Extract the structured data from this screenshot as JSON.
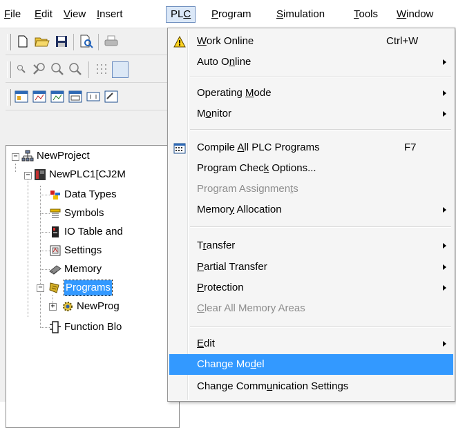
{
  "menubar": {
    "items": [
      {
        "pre": "",
        "u": "F",
        "post": "ile"
      },
      {
        "pre": "",
        "u": "E",
        "post": "dit"
      },
      {
        "pre": "",
        "u": "V",
        "post": "iew"
      },
      {
        "pre": "",
        "u": "I",
        "post": "nsert"
      },
      {
        "pre": "PL",
        "u": "C",
        "post": ""
      },
      {
        "pre": "",
        "u": "P",
        "post": "rogram"
      },
      {
        "pre": "",
        "u": "S",
        "post": "imulation"
      },
      {
        "pre": "",
        "u": "T",
        "post": "ools"
      },
      {
        "pre": "",
        "u": "W",
        "post": "indow"
      }
    ]
  },
  "tree": {
    "project": "NewProject",
    "plc": "NewPLC1[CJ2M",
    "data_types": "Data Types",
    "symbols": "Symbols",
    "io_table": "IO Table and",
    "settings": "Settings",
    "memory": "Memory",
    "programs": "Programs",
    "new_program": "NewProg",
    "function_blocks": "Function Blo"
  },
  "plc_menu": {
    "work_online": {
      "pre": "",
      "u": "W",
      "post": "ork Online",
      "shortcut": "Ctrl+W"
    },
    "auto_online": {
      "pre": "Auto O",
      "u": "n",
      "post": "line"
    },
    "operating_mode": {
      "pre": "Operating ",
      "u": "M",
      "post": "ode"
    },
    "monitor": {
      "pre": "M",
      "u": "o",
      "post": "nitor"
    },
    "compile_all": {
      "pre": "Compile ",
      "u": "A",
      "post": "ll PLC Programs",
      "shortcut": "F7"
    },
    "check_options": {
      "pre": "Program Chec",
      "u": "k",
      "post": " Options..."
    },
    "program_assignments": {
      "pre": "Program Assignmen",
      "u": "t",
      "post": "s"
    },
    "memory_allocation": {
      "pre": "Memor",
      "u": "y",
      "post": " Allocation"
    },
    "transfer": {
      "pre": "T",
      "u": "r",
      "post": "ansfer"
    },
    "partial_transfer": {
      "pre": "",
      "u": "P",
      "post": "artial Transfer"
    },
    "protection": {
      "pre": "",
      "u": "P",
      "post": "rotection"
    },
    "clear_memory": {
      "pre": "",
      "u": "C",
      "post": "lear All Memory Areas"
    },
    "edit": {
      "pre": "",
      "u": "E",
      "post": "dit"
    },
    "change_model": {
      "pre": "Change Mo",
      "u": "d",
      "post": "el"
    },
    "change_comm": {
      "pre": "Change Comm",
      "u": "u",
      "post": "nication Settings"
    }
  },
  "colors": {
    "highlight": "#3399ff",
    "menu_active_bg": "#dbe8f8",
    "disabled_text": "#8d8d8d"
  }
}
